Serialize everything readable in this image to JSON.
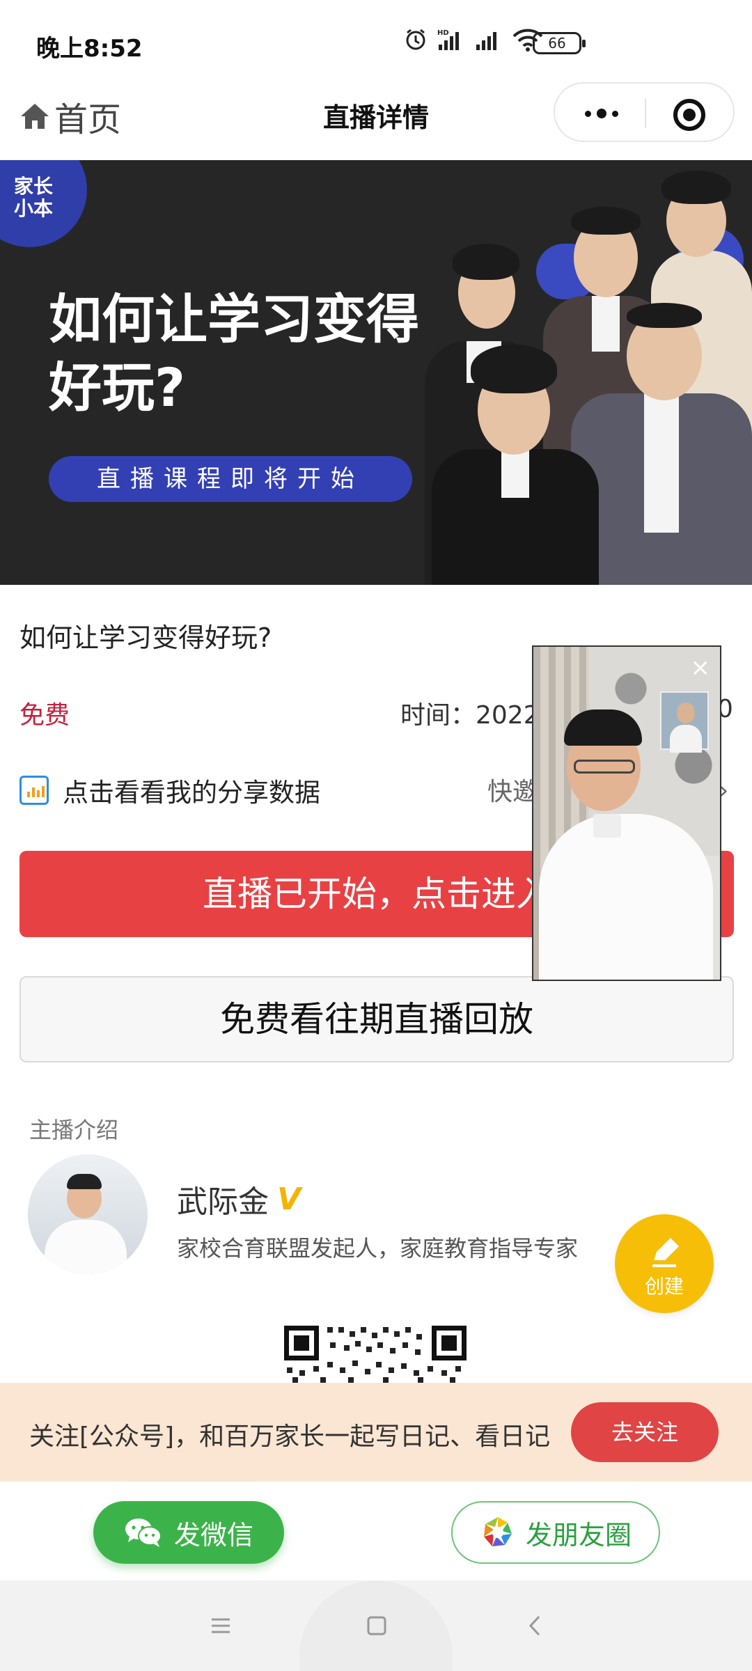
{
  "status_bar": {
    "time": "晚上8:52",
    "battery": "66"
  },
  "nav": {
    "home_label": "首页",
    "title": "直播详情"
  },
  "banner": {
    "logo_text": "家长小本",
    "headline": "如何让学习变得好玩?",
    "pill": "直播课程即将开始"
  },
  "course": {
    "title": "如何让学习变得好玩?",
    "price": "免费",
    "time_label": "时间：2022",
    "time_tail": "0"
  },
  "share_data": {
    "label": "点击看看我的分享数据",
    "invite": "快邀"
  },
  "buttons": {
    "enter": "直播已开始，点击进入",
    "replay": "免费看往期直播回放"
  },
  "host": {
    "section_title": "主播介绍",
    "name": "武际金",
    "description": "家校合育联盟发起人，家庭教育指导专家"
  },
  "fab": {
    "label": "创建"
  },
  "follow_bar": {
    "text": "关注[公众号]，和百万家长一起写日记、看日记",
    "button": "去关注"
  },
  "share_bar": {
    "wechat": "发微信",
    "moments": "发朋友圈"
  },
  "colors": {
    "accent_red": "#e84144",
    "price_red": "#c81e3c",
    "fab_yellow": "#f7be07",
    "wechat_green": "#3cb34a",
    "follow_bg": "#fbe6d3",
    "banner_blue": "#3340b4"
  },
  "icons": {
    "home": "home-icon",
    "more": "more-dots-icon",
    "close": "target-close-icon",
    "chart": "chart-icon",
    "pen": "pen-icon",
    "wechat": "wechat-icon",
    "moments": "moments-icon"
  }
}
